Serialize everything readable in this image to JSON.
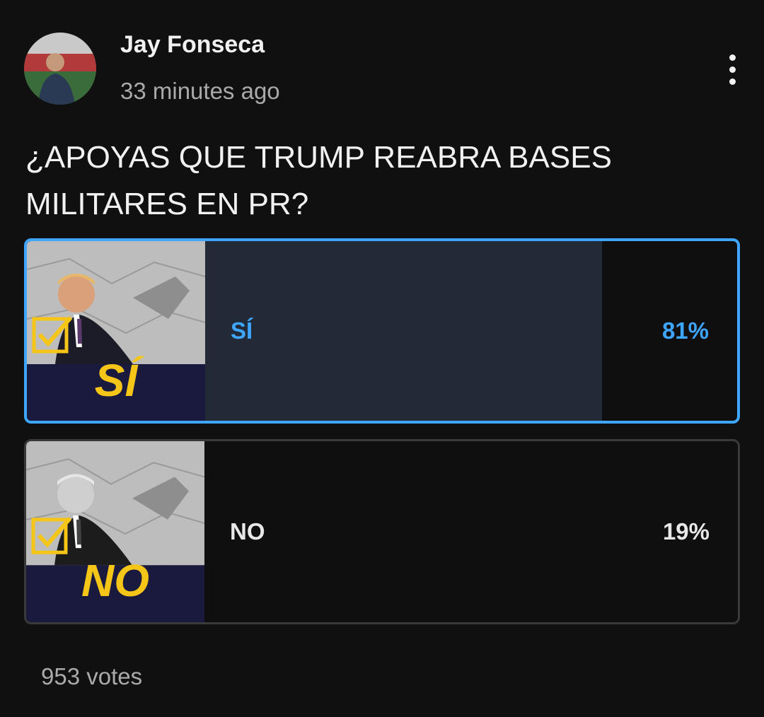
{
  "post": {
    "author": "Jay Fonseca",
    "time": "33 minutes ago",
    "question": "¿APOYAS QUE TRUMP REABRA BASES MILITARES EN PR?",
    "votes": "953 votes"
  },
  "poll": {
    "options": [
      {
        "label": "SÍ",
        "percent": "81%",
        "fraction": 0.81,
        "selected": true,
        "thumb_text": "SÍ",
        "icon": "checkbox-icon"
      },
      {
        "label": "NO",
        "percent": "19%",
        "fraction": 0.19,
        "selected": false,
        "thumb_text": "NO",
        "icon": "checkbox-icon"
      }
    ]
  },
  "colors": {
    "accent": "#3ea6ff",
    "background": "#101010",
    "thumb_yellow": "#f5c518",
    "thumb_navy": "#1a1a3e"
  }
}
